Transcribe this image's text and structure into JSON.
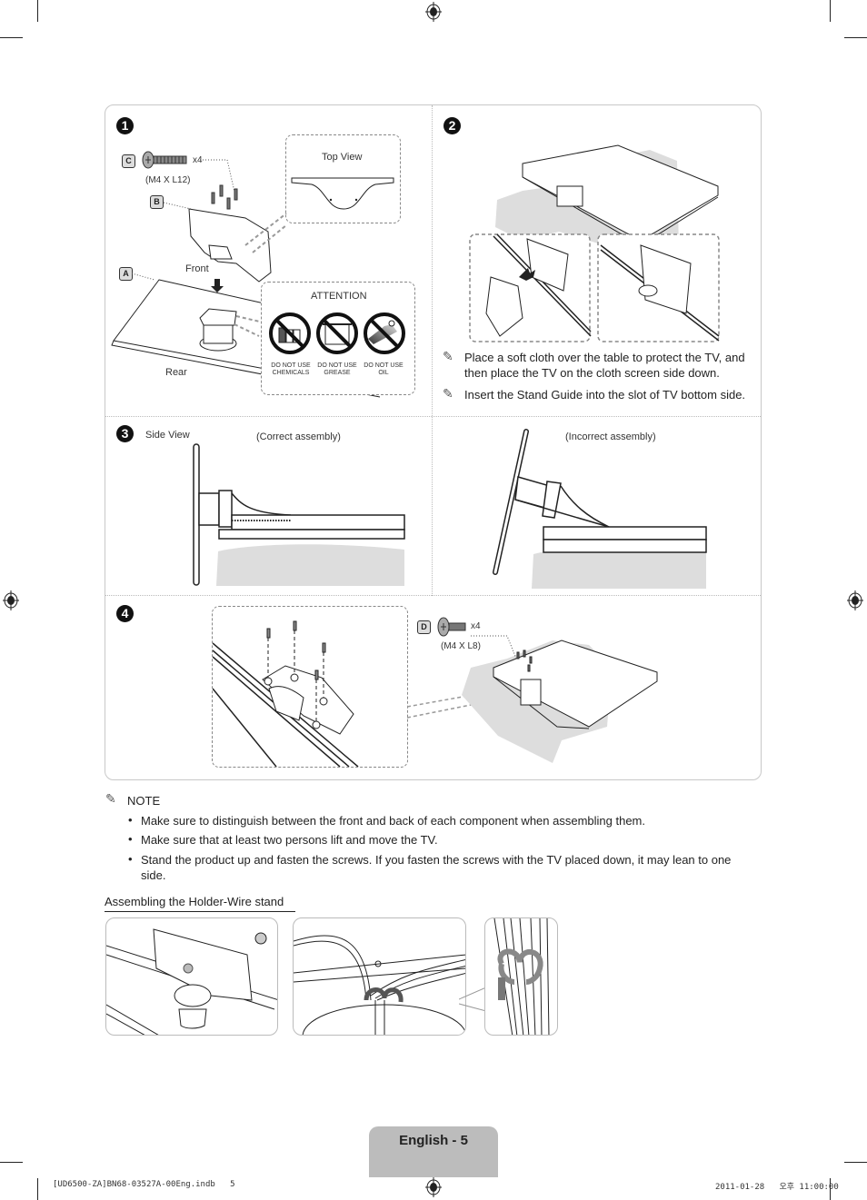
{
  "document": {
    "page_label": "English - 5",
    "footer_file": "[UD6500-ZA]BN68-03527A-00Eng.indb   5",
    "footer_timestamp": "2011-01-28   오후 11:00:00"
  },
  "step1": {
    "number": "1",
    "badge_c": "C",
    "badge_b": "B",
    "badge_a": "A",
    "screw_count": "x4",
    "screw_spec": "(M4 X L12)",
    "top_view_label": "Top View",
    "front_label": "Front",
    "rear_label": "Rear",
    "attention": {
      "title": "ATTENTION",
      "items": [
        {
          "line1": "DO NOT USE",
          "line2": "CHEMICALS",
          "icon": "no-chemicals-icon"
        },
        {
          "line1": "DO NOT USE",
          "line2": "GREASE",
          "icon": "no-grease-icon"
        },
        {
          "line1": "DO NOT USE",
          "line2": "OIL",
          "icon": "no-oil-icon"
        }
      ]
    }
  },
  "step2": {
    "number": "2",
    "notes": [
      "Place a soft cloth over the table to protect the TV, and",
      "then place the TV on the cloth screen side down.",
      "Insert the Stand Guide into the slot of TV bottom side."
    ]
  },
  "step3": {
    "number": "3",
    "side_view_label": "Side View",
    "correct_label": "(Correct assembly)",
    "incorrect_label": "(Incorrect assembly)"
  },
  "step4": {
    "number": "4",
    "badge_d": "D",
    "screw_count": "x4",
    "screw_spec": "(M4 X L8)"
  },
  "note": {
    "heading": "NOTE",
    "bullets": [
      "Make sure to distinguish between the front and back of each component when assembling them.",
      "Make sure that at least two persons lift and move the TV.",
      "Stand the product up and fasten the screws. If you fasten the screws with the TV placed down, it may lean to one",
      "side."
    ]
  },
  "holder_section": {
    "title": "Assembling the Holder-Wire stand"
  }
}
